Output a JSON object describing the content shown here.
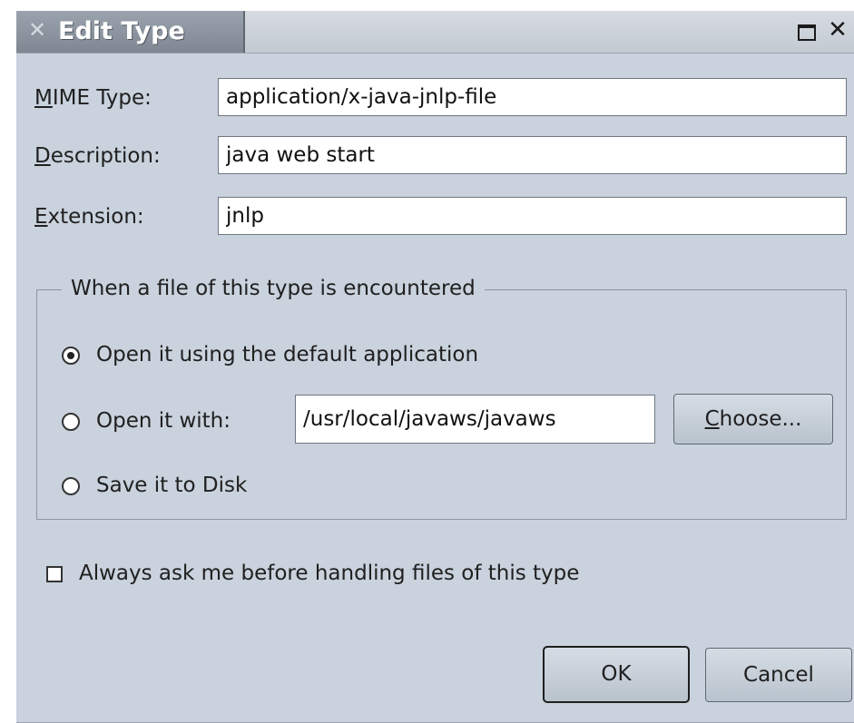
{
  "window": {
    "title": "Edit Type",
    "icons": {
      "app": "x-logo-icon",
      "maximize": "maximize-icon",
      "close": "close-icon"
    }
  },
  "form": {
    "mime_type": {
      "label_key": "M",
      "label_rest": "IME Type:",
      "value": "application/x-java-jnlp-file"
    },
    "description": {
      "label_key": "D",
      "label_rest": "escription:",
      "value": "java web start"
    },
    "extension": {
      "label_key": "E",
      "label_rest": "xtension:",
      "value": "jnlp"
    }
  },
  "group": {
    "legend": "When a file of this type is encountered",
    "options": [
      {
        "label": "Open it using the default application",
        "selected": true
      },
      {
        "label": "Open it with:",
        "selected": false
      },
      {
        "label": "Save it to Disk",
        "selected": false
      }
    ],
    "app_path": "/usr/local/javaws/javaws",
    "choose_key": "C",
    "choose_rest": "hoose..."
  },
  "always_ask": {
    "label": "Always ask me before handling files of this type",
    "checked": false
  },
  "buttons": {
    "ok": "OK",
    "cancel": "Cancel"
  },
  "colors": {
    "dialog_bg": "#c9d2dd",
    "title_tab": "#8b949e"
  }
}
